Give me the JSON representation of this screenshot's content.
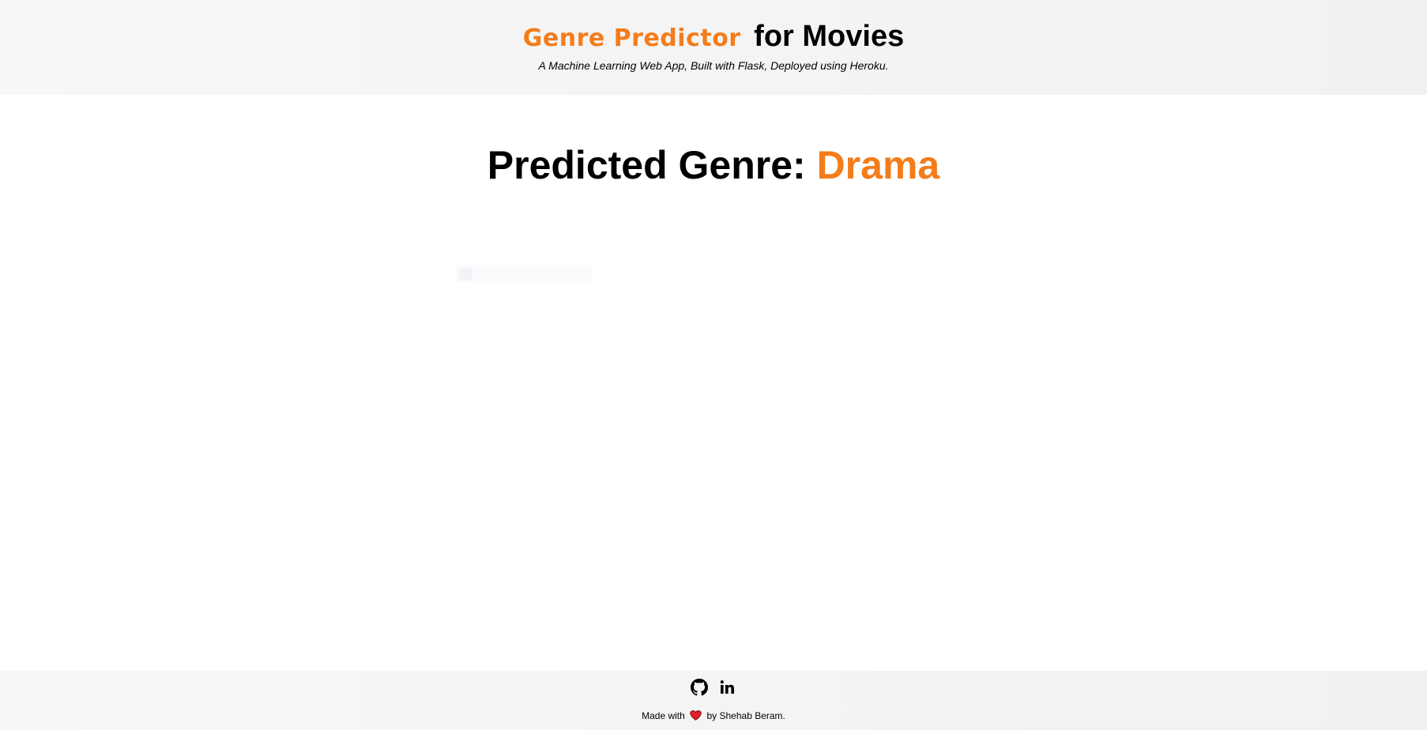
{
  "header": {
    "brand": "Genre Predictor",
    "title_rest": "for Movies",
    "subtitle": "A Machine Learning Web App, Built with Flask, Deployed using Heroku."
  },
  "main": {
    "prediction_label": "Predicted Genre:",
    "prediction_value": "Drama"
  },
  "footer": {
    "made_with": "Made with",
    "by_author": "by Shehab Beram."
  },
  "icons": {
    "github": "github-icon",
    "linkedin": "linkedin-icon",
    "heart": "heart-icon"
  },
  "colors": {
    "accent": "#f47c1b",
    "heart": "#e0202a"
  }
}
